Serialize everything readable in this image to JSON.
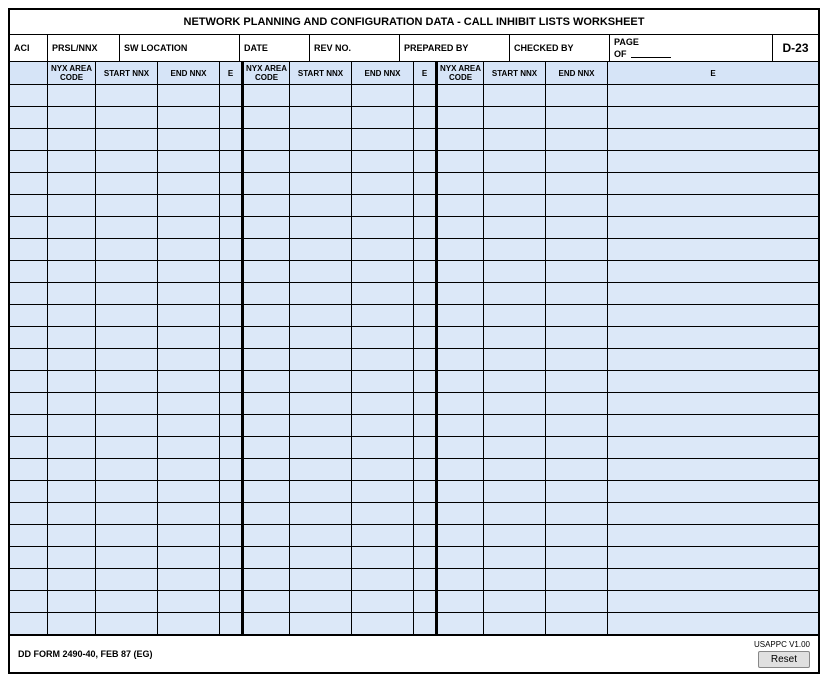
{
  "title": "NETWORK PLANNING AND CONFIGURATION DATA - CALL INHIBIT LISTS WORKSHEET",
  "header": {
    "aci_label": "ACI",
    "prsl_label": "PRSL/NNX",
    "sw_loc_label": "SW LOCATION",
    "date_label": "DATE",
    "rev_label": "REV NO.",
    "prepared_label": "PREPARED BY",
    "checked_label": "CHECKED BY",
    "page_label": "PAGE",
    "of_label": "OF",
    "page_id": "D-23"
  },
  "col_headers": {
    "nyx_area_code": "NYX AREA CODE",
    "start_nnx": "START NNX",
    "end_nnx": "END NNX",
    "e": "E"
  },
  "num_rows": 25,
  "footer": {
    "form_label": "DD FORM 2490-40, FEB 87 (EG)",
    "version_label": "USAPPC V1.00",
    "reset_label": "Reset"
  }
}
